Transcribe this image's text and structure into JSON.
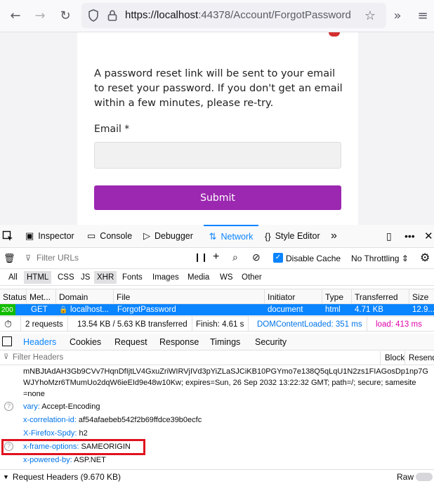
{
  "browser": {
    "url_host": "https://localhost",
    "url_rest": ":44378/Account/ForgotPassword"
  },
  "page": {
    "reset_message": "A password reset link will be sent to your email to reset your password. If you don't get an email within a few minutes, please re-try.",
    "email_label": "Email *",
    "email_value": "",
    "submit_label": "Submit",
    "accent": "#9c27b0"
  },
  "devtools": {
    "tabs": [
      {
        "label": "Inspector",
        "icon": "inspector-icon"
      },
      {
        "label": "Console",
        "icon": "console-icon"
      },
      {
        "label": "Debugger",
        "icon": "debugger-icon"
      },
      {
        "label": "Network",
        "icon": "network-icon"
      },
      {
        "label": "Style Editor",
        "icon": "style-editor-icon"
      }
    ],
    "filter_placeholder": "Filter URLs",
    "disable_cache_label": "Disable Cache",
    "throttling": "No Throttling",
    "types": [
      "All",
      "HTML",
      "CSS",
      "JS",
      "XHR",
      "Fonts",
      "Images",
      "Media",
      "WS",
      "Other"
    ],
    "columns": [
      "Status",
      "Met...",
      "Domain",
      "File",
      "Initiator",
      "Type",
      "Transferred",
      "Size"
    ],
    "request": {
      "status": "200",
      "method": "GET",
      "domain": "localhost...",
      "file": "ForgotPassword",
      "initiator": "document",
      "type": "html",
      "transferred": "4.71 KB",
      "size": "12.9..."
    },
    "summary": {
      "requests": "2 requests",
      "size": "13.54 KB / 5.63 KB transferred",
      "finish": "Finish: 4.61 s",
      "dom_loaded": "DOMContentLoaded: 351 ms",
      "load": "load: 413 ms"
    },
    "detail_tabs": [
      "Headers",
      "Cookies",
      "Request",
      "Response",
      "Timings",
      "Security"
    ],
    "headers_filter_placeholder": "Filter Headers",
    "block_label": "Block",
    "resend_label": "Resend",
    "cookie_lines": [
      "mNBJtAdAH3Gb9CVv7HqnDfIjtLV4GxuZriWIRVjIVd3pYiZLaSJCiKB10PGYmo7e138Q5qLqU1N2zs1FIAGosDp1np7G",
      "WJYhoMzr6TMumUo2dqW6ieEId9e48w10Kw; expires=Sun, 26 Sep 2032 13:22:32 GMT; path=/; secure; samesite",
      "=none"
    ],
    "headers": [
      {
        "name": "vary:",
        "value": "Accept-Encoding"
      },
      {
        "name": "x-correlation-id:",
        "value": "af54afaebeb542f2b69ffdce39b0ecfc"
      },
      {
        "name": "X-Firefox-Spdy:",
        "value": "h2"
      },
      {
        "name": "x-frame-options:",
        "value": "SAMEORIGIN"
      },
      {
        "name": "x-powered-by:",
        "value": "ASP.NET"
      }
    ],
    "request_headers_label": "Request Headers (9.670 KB)",
    "raw_label": "Raw"
  }
}
